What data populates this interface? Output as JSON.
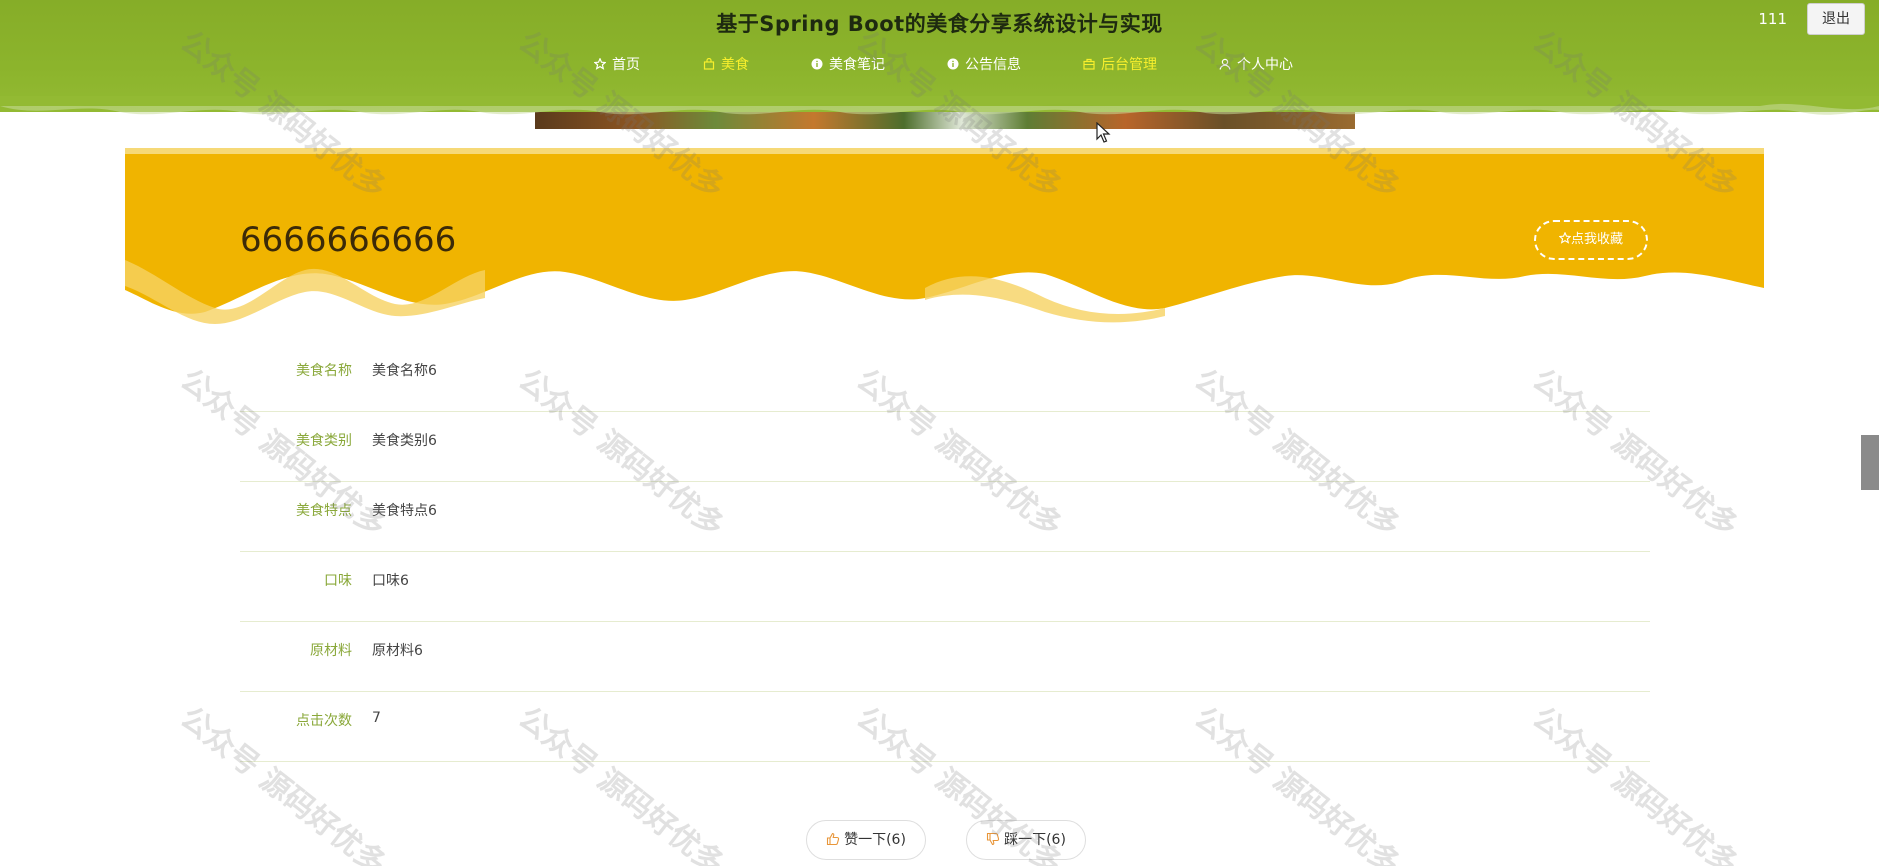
{
  "header": {
    "title": "基于Spring Boot的美食分享系统设计与实现",
    "nav": [
      {
        "label": "首页",
        "icon": "star-icon",
        "active": false
      },
      {
        "label": "美食",
        "icon": "bag-icon",
        "active": true
      },
      {
        "label": "美食笔记",
        "icon": "info-icon",
        "active": false
      },
      {
        "label": "公告信息",
        "icon": "info-icon",
        "active": false
      },
      {
        "label": "后台管理",
        "icon": "briefcase-icon",
        "active": true
      },
      {
        "label": "个人中心",
        "icon": "user-icon",
        "active": false
      }
    ],
    "user": "111",
    "logout_label": "退出"
  },
  "detail": {
    "title": "6666666666",
    "favorite_label": "点我收藏",
    "rows": [
      {
        "label": "美食名称",
        "value": "美食名称6"
      },
      {
        "label": "美食类别",
        "value": "美食类别6"
      },
      {
        "label": "美食特点",
        "value": "美食特点6"
      },
      {
        "label": "口味",
        "value": "口味6"
      },
      {
        "label": "原材料",
        "value": "原材料6"
      },
      {
        "label": "点击次数",
        "value": "7"
      }
    ],
    "like_label": "赞一下(6)",
    "dislike_label": "踩一下(6)"
  },
  "watermark": "公众号 源码好优多",
  "colors": {
    "header_green": "#8cb42c",
    "band_yellow": "#f0b400",
    "active_nav": "#f7ef2c",
    "label_green": "#8aa83a"
  }
}
